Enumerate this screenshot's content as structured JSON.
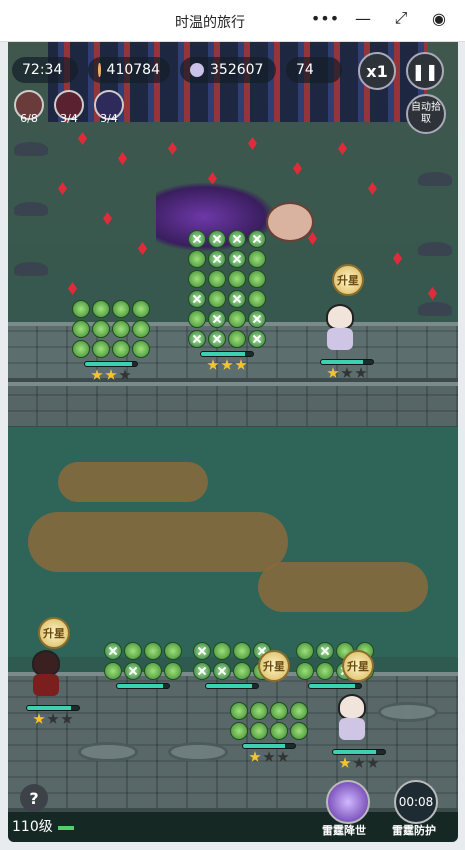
{
  "window": {
    "title": "时温的旅行",
    "more_icon": "more-dots-icon",
    "minimize_icon": "minimize-icon",
    "restore_icon": "restore-icon",
    "close_icon": "record-close-icon"
  },
  "hud": {
    "timer": "72:34",
    "coins": "410784",
    "score": "352607",
    "kills": "74",
    "speed": "x1",
    "pause_icon": "pause-icon",
    "auto_pickup": "自动拾取"
  },
  "skills": [
    {
      "icon": "swirl-skill-icon",
      "count": "6/8"
    },
    {
      "icon": "blade-skill-icon",
      "count": "3/4"
    },
    {
      "icon": "lightning-skill-icon",
      "count": "3/4"
    }
  ],
  "upgrade_label": "升星",
  "bottom": {
    "help": "?",
    "level": "110级",
    "ult1_label": "雷霆降世",
    "ult2_label": "雷霆防护",
    "ult2_timer": "00:08"
  }
}
